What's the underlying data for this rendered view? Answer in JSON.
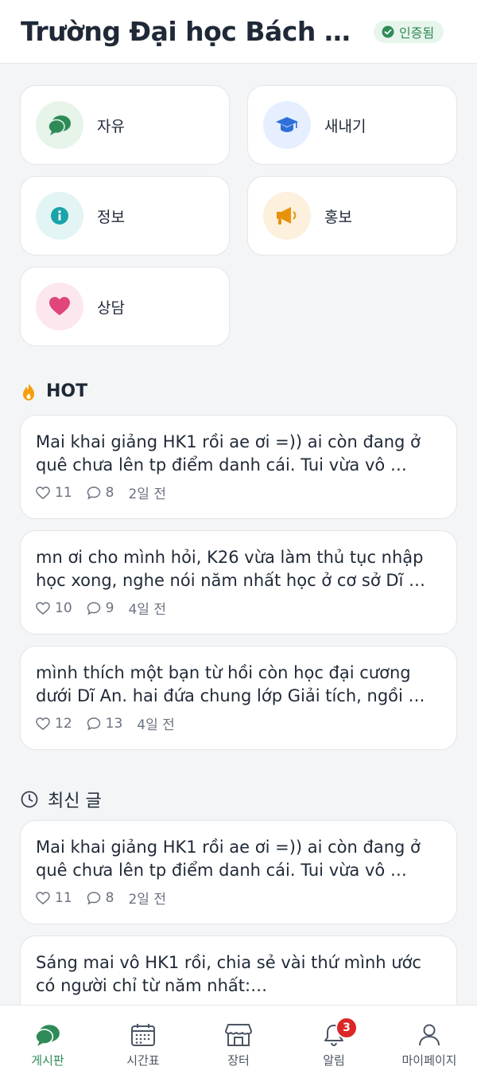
{
  "header": {
    "title": "Trường Đại học Bách k...",
    "verified_label": "인증됨"
  },
  "categories": [
    {
      "label": "자유",
      "icon": "chat-bubbles-icon",
      "color": "#2e8b57",
      "bg": "#e6f4ea"
    },
    {
      "label": "새내기",
      "icon": "graduation-cap-icon",
      "color": "#2f6fd8",
      "bg": "#e6efff"
    },
    {
      "label": "정보",
      "icon": "info-icon",
      "color": "#1aa3a8",
      "bg": "#e2f5f4"
    },
    {
      "label": "홍보",
      "icon": "megaphone-icon",
      "color": "#e8920c",
      "bg": "#fdf0dc"
    },
    {
      "label": "상담",
      "icon": "heart-icon",
      "color": "#e0457b",
      "bg": "#fde7ee"
    }
  ],
  "hot": {
    "title": "HOT",
    "posts": [
      {
        "text": "Mai khai giảng HK1 rồi ae ơi =)) ai còn đang ở quê chưa lên tp điểm danh cái. Tui vừa vô …",
        "likes": "11",
        "comments": "8",
        "time": "2일 전"
      },
      {
        "text": "mn ơi cho mình hỏi, K26 vừa làm thủ tục nhập học xong, nghe nói năm nhất học ở cơ sở Dĩ …",
        "likes": "10",
        "comments": "9",
        "time": "4일 전"
      },
      {
        "text": "mình thích một bạn từ hồi còn học đại cương dưới Dĩ An. hai đứa chung lớp Giải tích, ngồi …",
        "likes": "12",
        "comments": "13",
        "time": "4일 전"
      }
    ]
  },
  "latest": {
    "title": "최신 글",
    "posts": [
      {
        "text": "Mai khai giảng HK1 rồi ae ơi =)) ai còn đang ở quê chưa lên tp điểm danh cái. Tui vừa vô …",
        "likes": "11",
        "comments": "8",
        "time": "2일 전"
      },
      {
        "text": "Sáng mai vô HK1 rồi, chia sẻ vài thứ mình ước có người chỉ từ năm nhất:…",
        "likes": "",
        "comments": "",
        "time": ""
      }
    ]
  },
  "tabs": [
    {
      "label": "게시판",
      "icon": "board-icon",
      "active": true
    },
    {
      "label": "시간표",
      "icon": "calendar-icon",
      "active": false
    },
    {
      "label": "장터",
      "icon": "store-icon",
      "active": false
    },
    {
      "label": "알림",
      "icon": "bell-icon",
      "active": false,
      "badge": "3"
    },
    {
      "label": "마이페이지",
      "icon": "user-icon",
      "active": false
    }
  ],
  "colors": {
    "accent": "#2e8b57",
    "badge": "#dc2626",
    "hot": "#f59e0b"
  }
}
